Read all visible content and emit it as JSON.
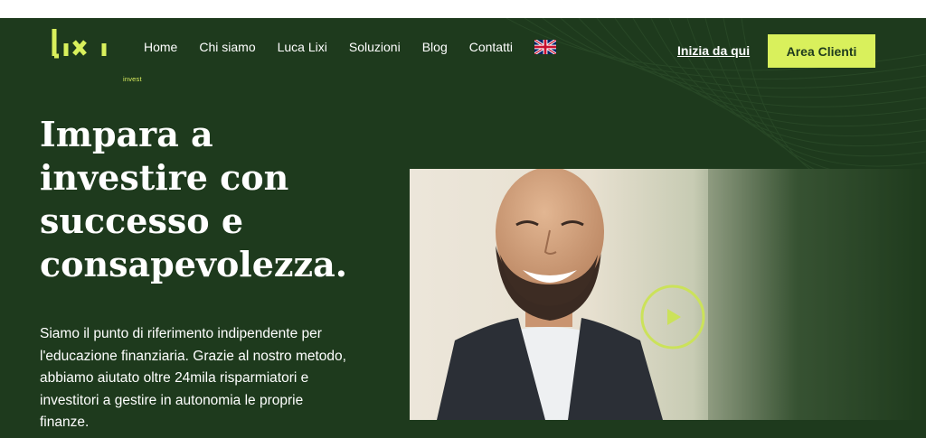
{
  "brand": {
    "logo_text": "lixi",
    "tagline": "invest"
  },
  "nav": {
    "items": [
      {
        "label": "Home"
      },
      {
        "label": "Chi siamo"
      },
      {
        "label": "Luca Lixi"
      },
      {
        "label": "Soluzioni"
      },
      {
        "label": "Blog"
      },
      {
        "label": "Contatti"
      }
    ],
    "language_icon": "uk-flag-icon"
  },
  "header": {
    "start_link": "Inizia da qui",
    "area_button": "Area Clienti"
  },
  "hero": {
    "headline_lines": [
      "Impara a",
      "investire con",
      "successo e",
      "consapevolezza."
    ],
    "description_lines": [
      "Siamo il punto di riferimento indipendente per",
      "l'educazione finanziaria. Grazie al nostro metodo,",
      "abbiamo aiutato oltre 24mila risparmiatori e",
      "investitori a gestire in autonomia le proprie",
      "finanze."
    ],
    "video_icon": "play-icon"
  },
  "colors": {
    "background": "#1e3a1d",
    "accent": "#d9f05c",
    "text": "#ffffff"
  }
}
